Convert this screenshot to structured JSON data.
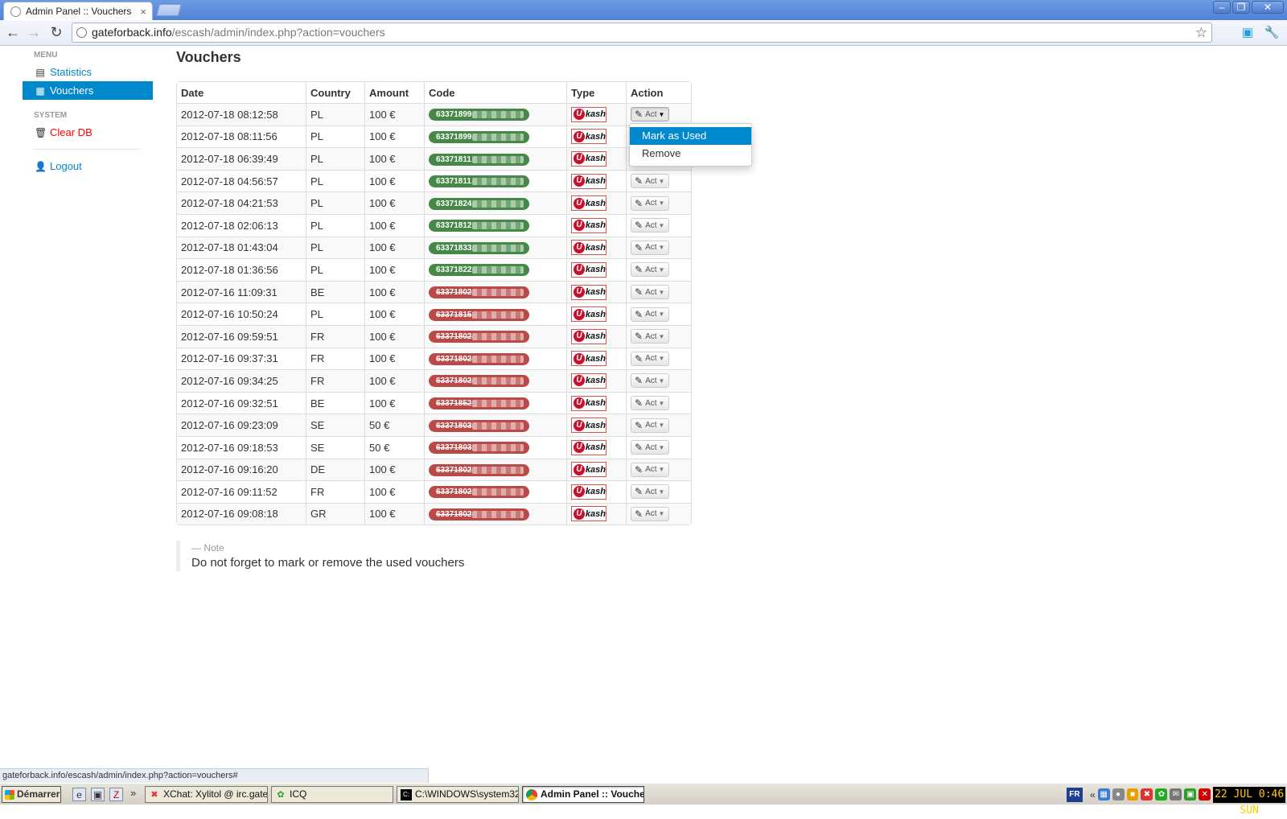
{
  "browser": {
    "tab_title": "Admin Panel :: Vouchers",
    "tab_close": "×",
    "url_host": "gateforback.info",
    "url_path": "/escash/admin/index.php?action=vouchers",
    "status_url": "gateforback.info/escash/admin/index.php?action=vouchers#"
  },
  "sidebar": {
    "menu_header": "MENU",
    "items": [
      {
        "label": "Statistics",
        "icon": "list-icon"
      },
      {
        "label": "Vouchers",
        "icon": "grid-icon"
      }
    ],
    "system_header": "SYSTEM",
    "clear_db": "Clear DB",
    "logout": "Logout"
  },
  "page": {
    "title": "Vouchers"
  },
  "table": {
    "headers": [
      "Date",
      "Country",
      "Amount",
      "Code",
      "Type",
      "Action"
    ],
    "action_label": "Act",
    "type_logo_u": "U",
    "type_logo_text": "kash",
    "rows": [
      {
        "date": "2012-07-18 08:12:58",
        "country": "PL",
        "amount": "100 €",
        "code": "63371899",
        "status": "valid"
      },
      {
        "date": "2012-07-18 08:11:56",
        "country": "PL",
        "amount": "100 €",
        "code": "63371899",
        "status": "valid"
      },
      {
        "date": "2012-07-18 06:39:49",
        "country": "PL",
        "amount": "100 €",
        "code": "63371811",
        "status": "valid"
      },
      {
        "date": "2012-07-18 04:56:57",
        "country": "PL",
        "amount": "100 €",
        "code": "63371811",
        "status": "valid"
      },
      {
        "date": "2012-07-18 04:21:53",
        "country": "PL",
        "amount": "100 €",
        "code": "63371824",
        "status": "valid"
      },
      {
        "date": "2012-07-18 02:06:13",
        "country": "PL",
        "amount": "100 €",
        "code": "63371812",
        "status": "valid"
      },
      {
        "date": "2012-07-18 01:43:04",
        "country": "PL",
        "amount": "100 €",
        "code": "63371833",
        "status": "valid"
      },
      {
        "date": "2012-07-18 01:36:56",
        "country": "PL",
        "amount": "100 €",
        "code": "63371822",
        "status": "valid"
      },
      {
        "date": "2012-07-16 11:09:31",
        "country": "BE",
        "amount": "100 €",
        "code": "63371802",
        "status": "used"
      },
      {
        "date": "2012-07-16 10:50:24",
        "country": "PL",
        "amount": "100 €",
        "code": "63371815",
        "status": "used"
      },
      {
        "date": "2012-07-16 09:59:51",
        "country": "FR",
        "amount": "100 €",
        "code": "63371802",
        "status": "used"
      },
      {
        "date": "2012-07-16 09:37:31",
        "country": "FR",
        "amount": "100 €",
        "code": "63371802",
        "status": "used"
      },
      {
        "date": "2012-07-16 09:34:25",
        "country": "FR",
        "amount": "100 €",
        "code": "63371802",
        "status": "used"
      },
      {
        "date": "2012-07-16 09:32:51",
        "country": "BE",
        "amount": "100 €",
        "code": "63371852",
        "status": "used"
      },
      {
        "date": "2012-07-16 09:23:09",
        "country": "SE",
        "amount": "50 €",
        "code": "63371803",
        "status": "used"
      },
      {
        "date": "2012-07-16 09:18:53",
        "country": "SE",
        "amount": "50 €",
        "code": "63371803",
        "status": "used"
      },
      {
        "date": "2012-07-16 09:16:20",
        "country": "DE",
        "amount": "100 €",
        "code": "63371802",
        "status": "used"
      },
      {
        "date": "2012-07-16 09:11:52",
        "country": "FR",
        "amount": "100 €",
        "code": "63371802",
        "status": "used"
      },
      {
        "date": "2012-07-16 09:08:18",
        "country": "GR",
        "amount": "100 €",
        "code": "63371802",
        "status": "used"
      }
    ]
  },
  "dropdown": {
    "items": [
      "Mark as Used",
      "Remove"
    ]
  },
  "note": {
    "label": "— Note",
    "text": "Do not forget to mark or remove the used vouchers"
  },
  "taskbar": {
    "start": "Démarrer",
    "more": "»",
    "tasks": [
      {
        "label": "XChat: Xylitol @ irc.gate...",
        "icon": "xchat-icon"
      },
      {
        "label": "ICQ",
        "icon": "icq-icon"
      },
      {
        "label": "C:\\WINDOWS\\system32...",
        "icon": "cmd-icon"
      },
      {
        "label": "Admin Panel :: Vouche...",
        "icon": "chrome-icon"
      }
    ],
    "lang": "FR",
    "tray_expand": "«",
    "clock": "22 JUL 0:46 SUN"
  },
  "colors": {
    "link": "#0088cc",
    "active_nav": "#0088cc",
    "valid_badge": "#468847",
    "used_badge": "#b94a48",
    "danger": "#ff0000"
  }
}
